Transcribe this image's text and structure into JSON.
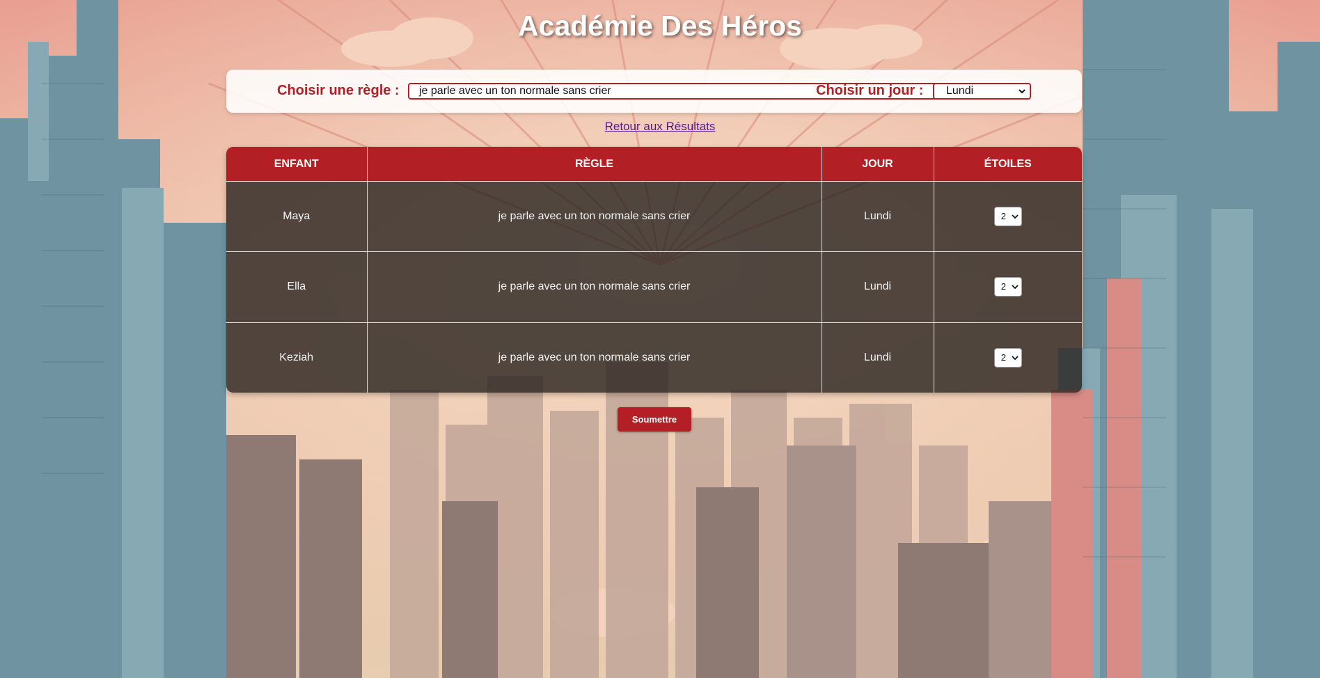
{
  "page": {
    "title": "Académie Des Héros"
  },
  "filters": {
    "rule_label": "Choisir une règle :",
    "rule_selected": "je parle avec un ton normale sans crier",
    "day_label": "Choisir un jour :",
    "day_selected": "Lundi"
  },
  "nav": {
    "back_link": "Retour aux Résultats"
  },
  "table": {
    "headers": [
      "ENFANT",
      "RÈGLE",
      "JOUR",
      "ÉTOILES"
    ],
    "rows": [
      {
        "enfant": "Maya",
        "regle": "je parle avec un ton normale sans crier",
        "jour": "Lundi",
        "etoiles": "2"
      },
      {
        "enfant": "Ella",
        "regle": "je parle avec un ton normale sans crier",
        "jour": "Lundi",
        "etoiles": "2"
      },
      {
        "enfant": "Keziah",
        "regle": "je parle avec un ton normale sans crier",
        "jour": "Lundi",
        "etoiles": "2"
      }
    ]
  },
  "actions": {
    "submit_label": "Soumettre"
  },
  "colors": {
    "accent": "#b21f24",
    "link": "#551a8b",
    "row_background": "#28221e"
  },
  "icons": {
    "select_chevron": "chevron-down-icon"
  }
}
